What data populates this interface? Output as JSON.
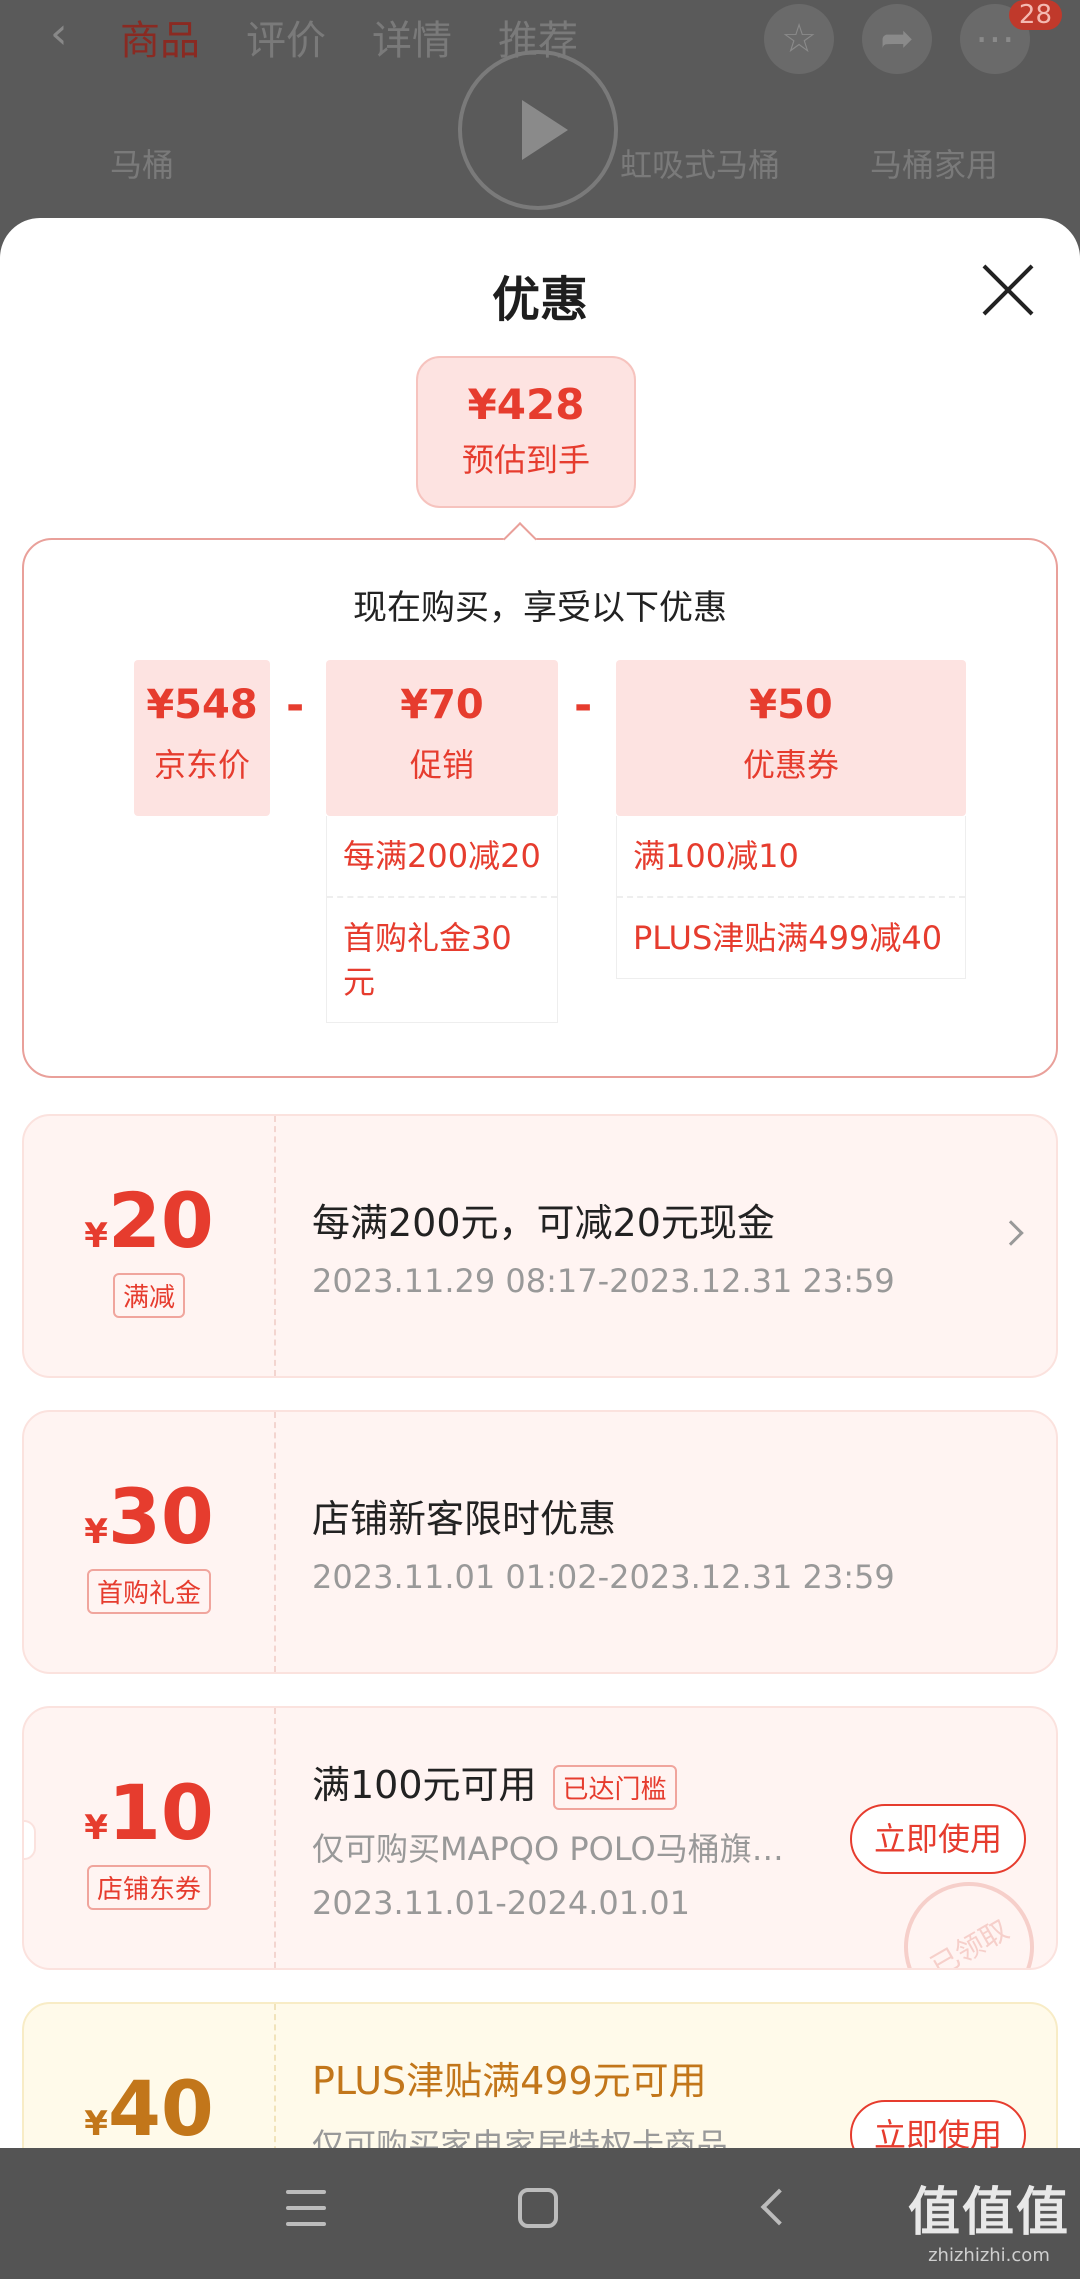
{
  "background": {
    "tabs": [
      "商品",
      "评价",
      "详情",
      "推荐"
    ],
    "active_tab": "商品",
    "badge": "28",
    "keywords": [
      "马桶",
      "虹吸式马桶",
      "马桶家用"
    ]
  },
  "sheet": {
    "title": "优惠",
    "estimate": {
      "price": "¥428",
      "label": "预估到手"
    },
    "breakdown": {
      "heading": "现在购买，享受以下优惠",
      "base": {
        "value": "¥548",
        "name": "京东价"
      },
      "promo": {
        "value": "¥70",
        "name": "促销",
        "items": [
          "每满200减20",
          "首购礼金30元"
        ]
      },
      "coupon": {
        "value": "¥50",
        "name": "优惠券",
        "items": [
          "满100减10",
          "PLUS津贴满499减40"
        ]
      },
      "minus": "-"
    }
  },
  "cards": [
    {
      "currency": "¥",
      "amount": "20",
      "tag": "满减",
      "title": "每满200元，可减20元现金",
      "date": "2023.11.29 08:17-2023.12.31 23:59"
    },
    {
      "currency": "¥",
      "amount": "30",
      "tag": "首购礼金",
      "title": "店铺新客限时优惠",
      "date": "2023.11.01 01:02-2023.12.31 23:59"
    },
    {
      "currency": "¥",
      "amount": "10",
      "tag": "店铺东券",
      "title": "满100元可用",
      "reached": "已达门槛",
      "desc": "仅可购买MAPQO POLO马桶旗…",
      "date": "2023.11.01-2024.01.01",
      "button": "立即使用",
      "stamp": "已领取"
    },
    {
      "currency": "¥",
      "amount": "40",
      "title": "PLUS津贴满499元可用",
      "desc": "仅可购买家电家居特权卡商品",
      "button": "立即使用"
    }
  ],
  "watermark": {
    "main": "值值值",
    "sub": "zhizhizhi.com"
  },
  "colors": {
    "accent": "#e63c2e",
    "gold": "#c2761a",
    "nav": "#545454"
  }
}
